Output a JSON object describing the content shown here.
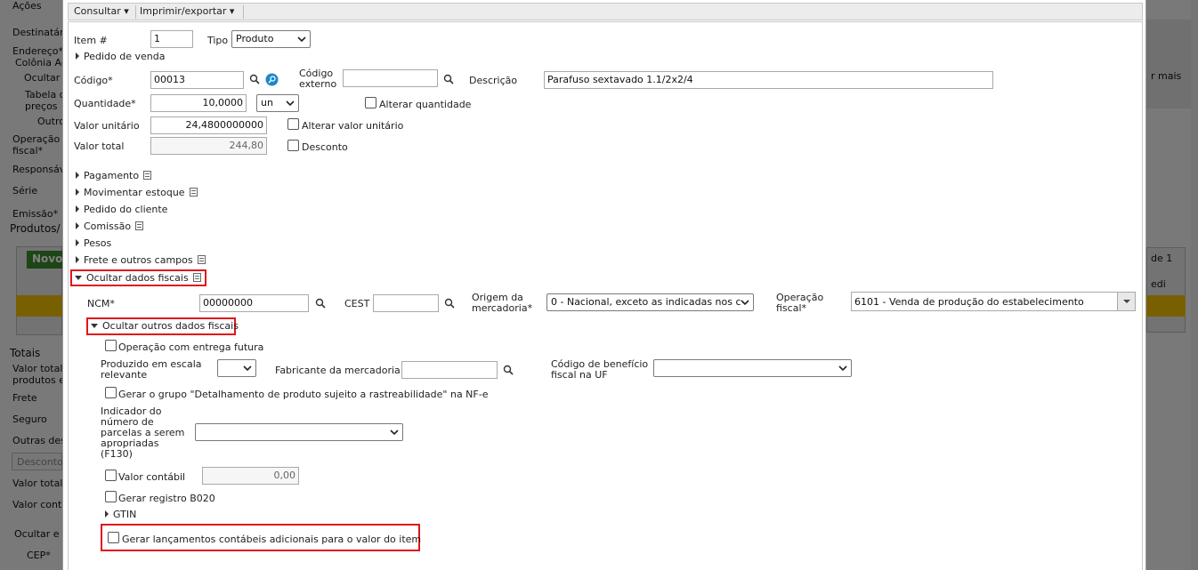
{
  "background": {
    "left_labels": [
      "Ações",
      "Destinatár",
      "Endereço*",
      "Colônia Ag",
      "Ocultar",
      "Tabela d",
      "preços",
      "Outro",
      "Operação",
      "fiscal*",
      "Responsáv",
      "Série",
      "Emissão*",
      "Produtos/",
      "Novo",
      "Totais",
      "Valor total",
      "produtos e",
      "Frete",
      "Seguro",
      "Outras des",
      "Desconto",
      "Valor total",
      "Valor conta",
      "Ocultar e",
      "CEP*"
    ],
    "right_labels": [
      "r mais",
      "de 1",
      "edi"
    ]
  },
  "toolbar": {
    "consultar": "Consultar",
    "imprimir": "Imprimir/exportar"
  },
  "form": {
    "item_label": "Item #",
    "item_value": "1",
    "tipo_label": "Tipo",
    "tipo_value": "Produto",
    "pedido_venda": "Pedido de venda",
    "codigo_label": "Código*",
    "codigo_value": "00013",
    "codigo_externo_label_1": "Código",
    "codigo_externo_label_2": "externo",
    "codigo_externo_value": "",
    "descricao_label": "Descrição",
    "descricao_value": "Parafuso sextavado 1.1/2x2/4",
    "quantidade_label": "Quantidade*",
    "quantidade_value": "10,0000",
    "unidade_value": "un",
    "alterar_quantidade": "Alterar quantidade",
    "valor_unitario_label": "Valor unitário",
    "valor_unitario_value": "24,4800000000",
    "alterar_valor_unitario": "Alterar valor unitário",
    "valor_total_label": "Valor total",
    "valor_total_value": "244,80",
    "desconto": "Desconto",
    "sections": [
      "Pagamento",
      "Movimentar estoque",
      "Pedido do cliente",
      "Comissão",
      "Pesos",
      "Frete e outros campos"
    ],
    "ocultar_dados_fiscais": "Ocultar dados fiscais",
    "ncm_label": "NCM*",
    "ncm_value": "00000000",
    "cest_label": "CEST",
    "cest_value": "",
    "origem_label_1": "Origem da",
    "origem_label_2": "mercadoria*",
    "origem_value": "0 - Nacional, exceto as indicadas nos c",
    "operacao_label_1": "Operação",
    "operacao_label_2": "fiscal*",
    "operacao_value": "6101 - Venda de produção do estabelecimento",
    "ocultar_outros": "Ocultar outros dados fiscais",
    "entrega_futura": "Operação com entrega futura",
    "escala_label_1": "Produzido em escala",
    "escala_label_2": "relevante",
    "escala_value": "",
    "fabricante_label": "Fabricante da mercadoria",
    "fabricante_value": "",
    "beneficio_label_1": "Código de benefício",
    "beneficio_label_2": "fiscal na UF",
    "beneficio_value": "",
    "rastreabilidade": "Gerar o grupo \"Detalhamento de produto sujeito a rastreabilidade\" na NF-e",
    "indicador_label": [
      "Indicador do",
      "número de",
      "parcelas a serem",
      "apropriadas",
      "(F130)"
    ],
    "indicador_value": "",
    "valor_contabil_label": "Valor contábil",
    "valor_contabil_value": "0,00",
    "b020": "Gerar registro B020",
    "gtin": "GTIN",
    "lancamentos": "Gerar lançamentos contábeis adicionais para o valor do item"
  },
  "colors": {
    "highlight": "#e0161b",
    "search_button": "#1e88c7",
    "overlay": "rgba(0,0,0,0.5)",
    "novo_button": "#3a8a2a"
  },
  "icons": [
    "search-icon",
    "details-icon",
    "chevron-down-icon",
    "caret-right-icon",
    "caret-down-icon",
    "list-icon",
    "checkbox"
  ]
}
